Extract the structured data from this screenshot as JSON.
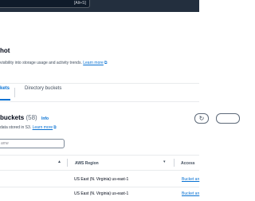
{
  "topbar": {
    "shortcut": "[Alt+S]"
  },
  "snapshot": {
    "title": "hot",
    "description": "visibility into storage usage and activity trends.",
    "learn_more": "Learn more"
  },
  "tabs": [
    {
      "label": "kets"
    },
    {
      "label": "Directory buckets"
    }
  ],
  "buckets": {
    "title": "buckets",
    "count": "(58)",
    "info": "Info",
    "description": "data stored in S3.",
    "learn_more": "Learn more",
    "search_placeholder": "ame"
  },
  "table": {
    "columns": [
      {
        "label": "AWS Region"
      },
      {
        "label": "Access"
      }
    ],
    "rows": [
      {
        "region": "US East (N. Virginia) us-east-1",
        "access": "Bucket an"
      },
      {
        "region": "US East (N. Virginia) us-east-1",
        "access": "Bucket an"
      }
    ]
  }
}
